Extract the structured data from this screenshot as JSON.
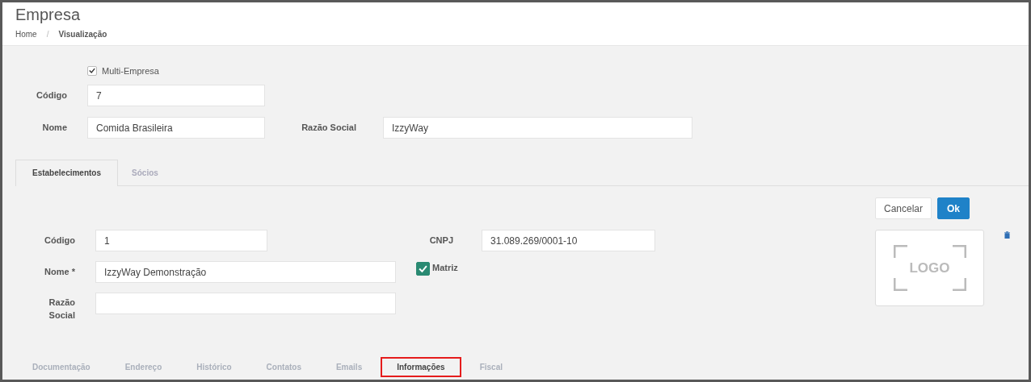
{
  "page": {
    "title": "Empresa",
    "breadcrumb_separator": "/",
    "breadcrumb": [
      {
        "label": "Home",
        "current": false
      },
      {
        "label": "Visualização",
        "current": true
      }
    ]
  },
  "company": {
    "multi_empresa": {
      "label": "Multi-Empresa",
      "checked": true
    },
    "codigo": {
      "label": "Código",
      "value": "7"
    },
    "nome": {
      "label": "Nome",
      "value": "Comida Brasileira"
    },
    "razao_social": {
      "label": "Razão Social",
      "value": "IzzyWay"
    }
  },
  "tabs": [
    {
      "label": "Estabelecimentos",
      "selected": true
    },
    {
      "label": "Sócios",
      "selected": false
    }
  ],
  "establishment": {
    "buttons": [
      {
        "label": "Cancelar",
        "kind": "default"
      },
      {
        "label": "Ok",
        "kind": "primary"
      }
    ],
    "codigo": {
      "label": "Código",
      "value": "1"
    },
    "cnpj": {
      "label": "CNPJ",
      "value": "31.089.269/0001-10"
    },
    "nome": {
      "label": "Nome *",
      "value": "IzzyWay Demonstração"
    },
    "matriz": {
      "label": "Matriz",
      "checked": true
    },
    "razao_social": {
      "label": "Razão Social"
    },
    "logo": {
      "text": "LOGO"
    }
  },
  "sub_tabs": [
    {
      "label": "Documentação",
      "selected": false
    },
    {
      "label": "Endereço",
      "selected": false
    },
    {
      "label": "Histórico",
      "selected": false
    },
    {
      "label": "Contatos",
      "selected": false
    },
    {
      "label": "Emails",
      "selected": false
    },
    {
      "label": "Informações",
      "selected": true
    },
    {
      "label": "Fiscal",
      "selected": false
    }
  ]
}
